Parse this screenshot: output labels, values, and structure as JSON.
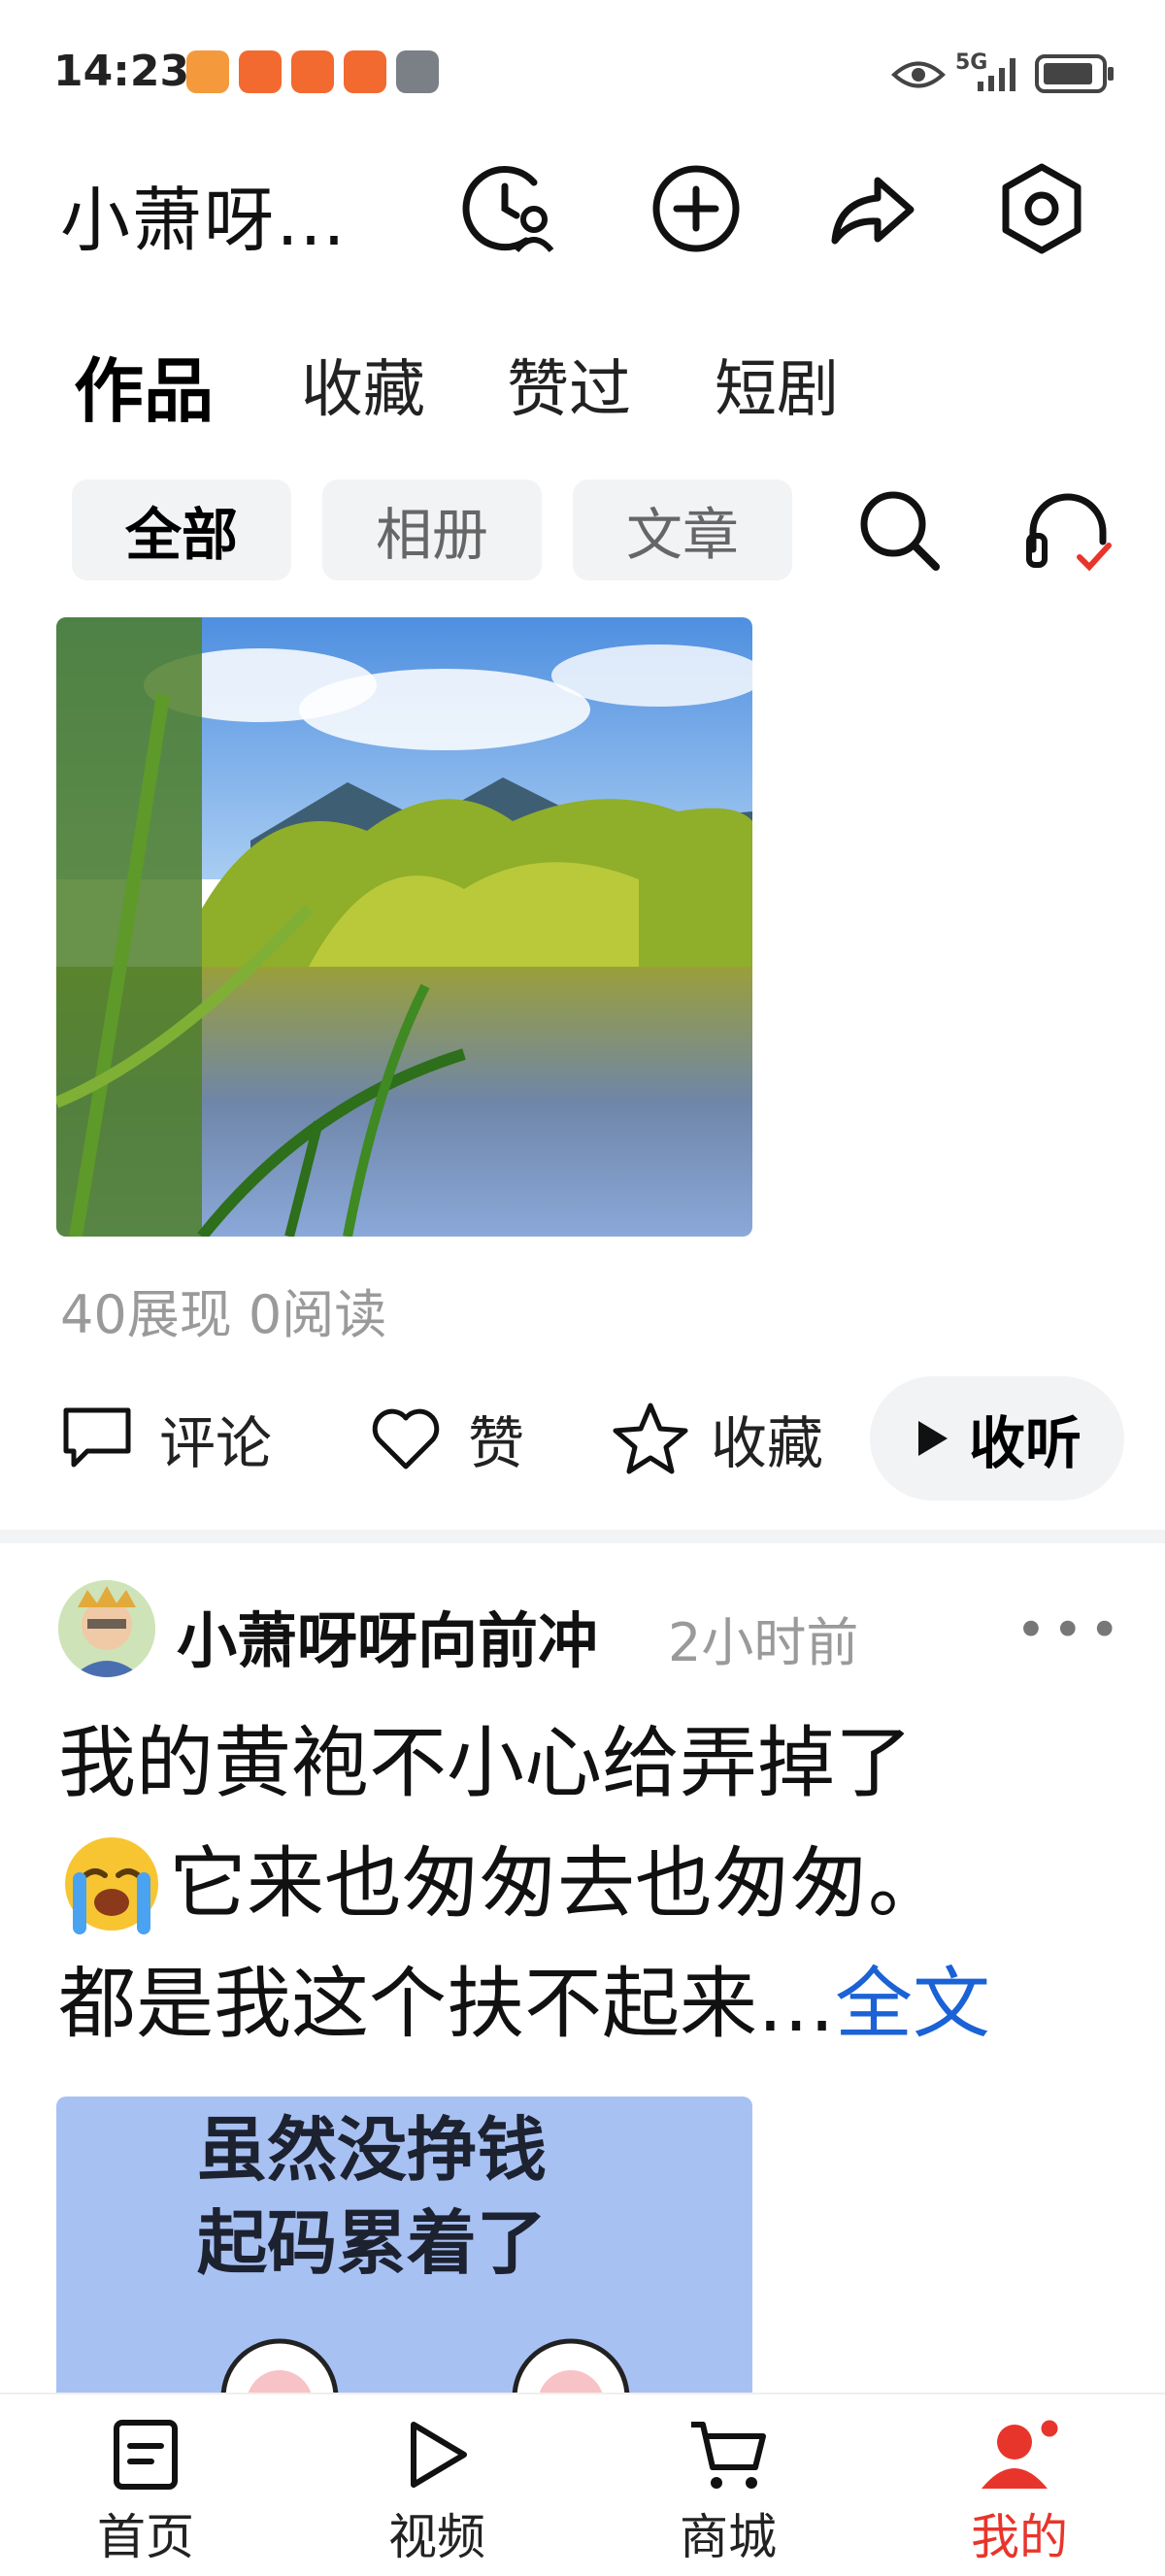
{
  "status_bar": {
    "time": "14:23",
    "network": "5G"
  },
  "header": {
    "title": "小萧呀…"
  },
  "tabs": [
    "作品",
    "收藏",
    "赞过",
    "短剧"
  ],
  "chips": [
    "全部",
    "相册",
    "文章"
  ],
  "post1": {
    "stats": "40展现  0阅读",
    "actions": {
      "comment": "评论",
      "like": "赞",
      "favorite": "收藏",
      "listen": "收听"
    }
  },
  "post2": {
    "author": "小萧呀呀向前冲",
    "time_ago": "2小时前",
    "line1": "我的黄袍不小心给弄掉了",
    "line2": "它来也匆匆去也匆匆。",
    "line3": "都是我这个扶不起来…",
    "full_text_link": "全文",
    "image_caption_1": "虽然没挣钱",
    "image_caption_2": "起码累着了"
  },
  "bottom_nav": [
    "首页",
    "视频",
    "商城",
    "我的"
  ],
  "colors": {
    "accent_red": "#e8352b",
    "link_blue": "#1a62d6",
    "chip_bg": "#f2f3f5"
  }
}
